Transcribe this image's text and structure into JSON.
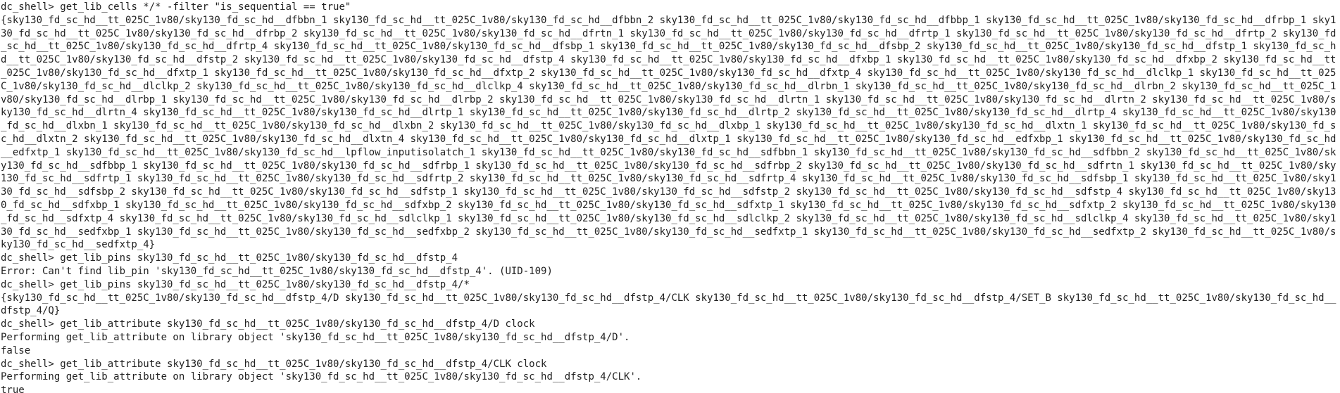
{
  "terminal": {
    "lines": [
      {
        "type": "command",
        "prompt": "dc_shell> ",
        "text": "get_lib_cells */* -filter \"is_sequential == true\""
      },
      {
        "type": "output",
        "text": "{sky130_fd_sc_hd__tt_025C_1v80/sky130_fd_sc_hd__dfbbn_1 sky130_fd_sc_hd__tt_025C_1v80/sky130_fd_sc_hd__dfbbn_2 sky130_fd_sc_hd__tt_025C_1v80/sky130_fd_sc_hd__dfbbp_1 sky130_fd_sc_hd__tt_025C_1v80/sky130_fd_sc_hd__dfrbp_1 sky130_fd_sc_hd__tt_025C_1v80/sky130_fd_sc_hd__dfrbp_2 sky130_fd_sc_hd__tt_025C_1v80/sky130_fd_sc_hd__dfrtn_1 sky130_fd_sc_hd__tt_025C_1v80/sky130_fd_sc_hd__dfrtp_1 sky130_fd_sc_hd__tt_025C_1v80/sky130_fd_sc_hd__dfrtp_2 sky130_fd_sc_hd__tt_025C_1v80/sky130_fd_sc_hd__dfrtp_4 sky130_fd_sc_hd__tt_025C_1v80/sky130_fd_sc_hd__dfsbp_1 sky130_fd_sc_hd__tt_025C_1v80/sky130_fd_sc_hd__dfsbp_2 sky130_fd_sc_hd__tt_025C_1v80/sky130_fd_sc_hd__dfstp_1 sky130_fd_sc_hd__tt_025C_1v80/sky130_fd_sc_hd__dfstp_2 sky130_fd_sc_hd__tt_025C_1v80/sky130_fd_sc_hd__dfstp_4 sky130_fd_sc_hd__tt_025C_1v80/sky130_fd_sc_hd__dfxbp_1 sky130_fd_sc_hd__tt_025C_1v80/sky130_fd_sc_hd__dfxbp_2 sky130_fd_sc_hd__tt_025C_1v80/sky130_fd_sc_hd__dfxtp_1 sky130_fd_sc_hd__tt_025C_1v80/sky130_fd_sc_hd__dfxtp_2 sky130_fd_sc_hd__tt_025C_1v80/sky130_fd_sc_hd__dfxtp_4 sky130_fd_sc_hd__tt_025C_1v80/sky130_fd_sc_hd__dlclkp_1 sky130_fd_sc_hd__tt_025C_1v80/sky130_fd_sc_hd__dlclkp_2 sky130_fd_sc_hd__tt_025C_1v80/sky130_fd_sc_hd__dlclkp_4 sky130_fd_sc_hd__tt_025C_1v80/sky130_fd_sc_hd__dlrbn_1 sky130_fd_sc_hd__tt_025C_1v80/sky130_fd_sc_hd__dlrbn_2 sky130_fd_sc_hd__tt_025C_1v80/sky130_fd_sc_hd__dlrbp_1 sky130_fd_sc_hd__tt_025C_1v80/sky130_fd_sc_hd__dlrbp_2 sky130_fd_sc_hd__tt_025C_1v80/sky130_fd_sc_hd__dlrtn_1 sky130_fd_sc_hd__tt_025C_1v80/sky130_fd_sc_hd__dlrtn_2 sky130_fd_sc_hd__tt_025C_1v80/sky130_fd_sc_hd__dlrtn_4 sky130_fd_sc_hd__tt_025C_1v80/sky130_fd_sc_hd__dlrtp_1 sky130_fd_sc_hd__tt_025C_1v80/sky130_fd_sc_hd__dlrtp_2 sky130_fd_sc_hd__tt_025C_1v80/sky130_fd_sc_hd__dlrtp_4 sky130_fd_sc_hd__tt_025C_1v80/sky130_fd_sc_hd__dlxbn_1 sky130_fd_sc_hd__tt_025C_1v80/sky130_fd_sc_hd__dlxbn_2 sky130_fd_sc_hd__tt_025C_1v80/sky130_fd_sc_hd__dlxbp_1 sky130_fd_sc_hd__tt_025C_1v80/sky130_fd_sc_hd__dlxtn_1 sky130_fd_sc_hd__tt_025C_1v80/sky130_fd_sc_hd__dlxtn_2 sky130_fd_sc_hd__tt_025C_1v80/sky130_fd_sc_hd__dlxtn_4 sky130_fd_sc_hd__tt_025C_1v80/sky130_fd_sc_hd__dlxtp_1 sky130_fd_sc_hd__tt_025C_1v80/sky130_fd_sc_hd__edfxbp_1 sky130_fd_sc_hd__tt_025C_1v80/sky130_fd_sc_hd__edfxtp_1 sky130_fd_sc_hd__tt_025C_1v80/sky130_fd_sc_hd__lpflow_inputisolatch_1 sky130_fd_sc_hd__tt_025C_1v80/sky130_fd_sc_hd__sdfbbn_1 sky130_fd_sc_hd__tt_025C_1v80/sky130_fd_sc_hd__sdfbbn_2 sky130_fd_sc_hd__tt_025C_1v80/sky130_fd_sc_hd__sdfbbp_1 sky130_fd_sc_hd__tt_025C_1v80/sky130_fd_sc_hd__sdfrbp_1 sky130_fd_sc_hd__tt_025C_1v80/sky130_fd_sc_hd__sdfrbp_2 sky130_fd_sc_hd__tt_025C_1v80/sky130_fd_sc_hd__sdfrtn_1 sky130_fd_sc_hd__tt_025C_1v80/sky130_fd_sc_hd__sdfrtp_1 sky130_fd_sc_hd__tt_025C_1v80/sky130_fd_sc_hd__sdfrtp_2 sky130_fd_sc_hd__tt_025C_1v80/sky130_fd_sc_hd__sdfrtp_4 sky130_fd_sc_hd__tt_025C_1v80/sky130_fd_sc_hd__sdfsbp_1 sky130_fd_sc_hd__tt_025C_1v80/sky130_fd_sc_hd__sdfsbp_2 sky130_fd_sc_hd__tt_025C_1v80/sky130_fd_sc_hd__sdfstp_1 sky130_fd_sc_hd__tt_025C_1v80/sky130_fd_sc_hd__sdfstp_2 sky130_fd_sc_hd__tt_025C_1v80/sky130_fd_sc_hd__sdfstp_4 sky130_fd_sc_hd__tt_025C_1v80/sky130_fd_sc_hd__sdfxbp_1 sky130_fd_sc_hd__tt_025C_1v80/sky130_fd_sc_hd__sdfxbp_2 sky130_fd_sc_hd__tt_025C_1v80/sky130_fd_sc_hd__sdfxtp_1 sky130_fd_sc_hd__tt_025C_1v80/sky130_fd_sc_hd__sdfxtp_2 sky130_fd_sc_hd__tt_025C_1v80/sky130_fd_sc_hd__sdfxtp_4 sky130_fd_sc_hd__tt_025C_1v80/sky130_fd_sc_hd__sdlclkp_1 sky130_fd_sc_hd__tt_025C_1v80/sky130_fd_sc_hd__sdlclkp_2 sky130_fd_sc_hd__tt_025C_1v80/sky130_fd_sc_hd__sdlclkp_4 sky130_fd_sc_hd__tt_025C_1v80/sky130_fd_sc_hd__sedfxbp_1 sky130_fd_sc_hd__tt_025C_1v80/sky130_fd_sc_hd__sedfxbp_2 sky130_fd_sc_hd__tt_025C_1v80/sky130_fd_sc_hd__sedfxtp_1 sky130_fd_sc_hd__tt_025C_1v80/sky130_fd_sc_hd__sedfxtp_2 sky130_fd_sc_hd__tt_025C_1v80/sky130_fd_sc_hd__sedfxtp_4}"
      },
      {
        "type": "command",
        "prompt": "dc_shell> ",
        "text": "get_lib_pins sky130_fd_sc_hd__tt_025C_1v80/sky130_fd_sc_hd__dfstp_4"
      },
      {
        "type": "output",
        "text": "Error: Can't find lib_pin 'sky130_fd_sc_hd__tt_025C_1v80/sky130_fd_sc_hd__dfstp_4'. (UID-109)"
      },
      {
        "type": "command",
        "prompt": "dc_shell> ",
        "text": "get_lib_pins sky130_fd_sc_hd__tt_025C_1v80/sky130_fd_sc_hd__dfstp_4/*"
      },
      {
        "type": "output",
        "text": "{sky130_fd_sc_hd__tt_025C_1v80/sky130_fd_sc_hd__dfstp_4/D sky130_fd_sc_hd__tt_025C_1v80/sky130_fd_sc_hd__dfstp_4/CLK sky130_fd_sc_hd__tt_025C_1v80/sky130_fd_sc_hd__dfstp_4/SET_B sky130_fd_sc_hd__tt_025C_1v80/sky130_fd_sc_hd__dfstp_4/Q}"
      },
      {
        "type": "command",
        "prompt": "dc_shell> ",
        "text": "get_lib_attribute sky130_fd_sc_hd__tt_025C_1v80/sky130_fd_sc_hd__dfstp_4/D clock"
      },
      {
        "type": "output",
        "text": "Performing get_lib_attribute on library object 'sky130_fd_sc_hd__tt_025C_1v80/sky130_fd_sc_hd__dfstp_4/D'."
      },
      {
        "type": "output",
        "text": "false"
      },
      {
        "type": "command",
        "prompt": "dc_shell> ",
        "text": "get_lib_attribute sky130_fd_sc_hd__tt_025C_1v80/sky130_fd_sc_hd__dfstp_4/CLK clock"
      },
      {
        "type": "output",
        "text": "Performing get_lib_attribute on library object 'sky130_fd_sc_hd__tt_025C_1v80/sky130_fd_sc_hd__dfstp_4/CLK'."
      },
      {
        "type": "output",
        "text": "true"
      }
    ]
  }
}
